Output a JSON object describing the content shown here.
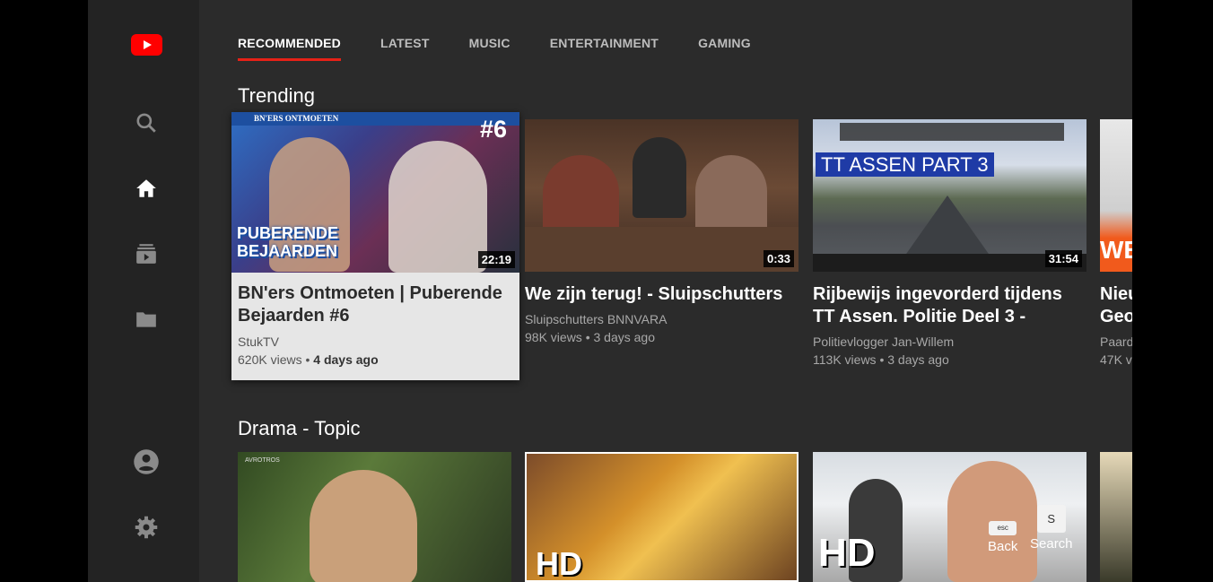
{
  "tabs": [
    "RECOMMENDED",
    "LATEST",
    "MUSIC",
    "ENTERTAINMENT",
    "GAMING"
  ],
  "sections": {
    "trending": "Trending",
    "drama": "Drama - Topic"
  },
  "trending": [
    {
      "title_line1": "BN'ers Ontmoeten | Puberende",
      "title_line2": "Bejaarden #6",
      "channel": "StukTV",
      "views": "620K views",
      "age": "4 days ago",
      "duration": "22:19",
      "thumb_header": "BN'ERS ONTMOETEN",
      "thumb_num": "#6",
      "thumb_overlay": "PUBERENDE BEJAARDEN"
    },
    {
      "title_line1": "We zijn terug! - Sluipschutters",
      "title_line2": "",
      "channel": "Sluipschutters BNNVARA",
      "views": "98K views",
      "age": "3 days ago",
      "duration": "0:33"
    },
    {
      "title_line1": "Rijbewijs ingevorderd tijdens",
      "title_line2": "TT Assen. Politie Deel 3 -",
      "channel": "Politievlogger Jan-Willem",
      "views": "113K views",
      "age": "3 days ago",
      "duration": "31:54",
      "thumb_banner": "TT ASSEN PART 3"
    },
    {
      "title_line1": "Nieu",
      "title_line2": "Geo",
      "channel": "Paard",
      "views": "47K v",
      "age": "",
      "duration": ""
    }
  ],
  "drama": [
    {
      "badge": "AVROTROS"
    },
    {
      "badge": "HD"
    },
    {
      "badge": "HD"
    },
    {
      "badge": ""
    }
  ],
  "hints": {
    "back_key": "esc",
    "back_label": "Back",
    "search_key": "S",
    "search_label": "Search"
  },
  "colors": {
    "accent": "#e62117",
    "logo": "#ff0000"
  },
  "icons": [
    "youtube-logo-icon",
    "search-icon",
    "home-icon",
    "subscriptions-icon",
    "library-icon",
    "account-icon",
    "settings-icon"
  ]
}
